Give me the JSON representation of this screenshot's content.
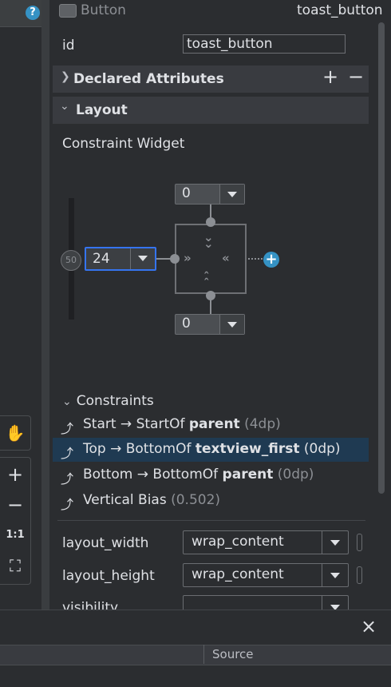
{
  "left_toolbar": {
    "help_glyph": "?",
    "tools": [
      {
        "name": "pan-hand-icon",
        "glyph": "✋"
      },
      {
        "name": "zoom-in-icon",
        "glyph": "+"
      },
      {
        "name": "zoom-out-icon",
        "glyph": "−"
      },
      {
        "name": "actual-size-icon",
        "glyph": "1:1"
      },
      {
        "name": "zoom-to-fit-icon",
        "glyph": "⛶"
      }
    ]
  },
  "header": {
    "component_type": "Button",
    "component_id": "toast_button"
  },
  "id_field": {
    "label": "id",
    "value": "toast_button"
  },
  "sections": {
    "declared_attributes": "Declared Attributes",
    "layout": "Layout",
    "add_glyph": "+",
    "remove_glyph": "−",
    "collapsed_chevron": "›",
    "expanded_chevron": "⌄"
  },
  "constraint_widget": {
    "label": "Constraint Widget",
    "top_margin": "0",
    "bottom_margin": "0",
    "start_margin": "24",
    "vertical_bias_knob": "50"
  },
  "constraints": {
    "header": "Constraints",
    "items": [
      {
        "prefix": "Start → StartOf ",
        "target": "parent",
        "suffix": " (4dp)",
        "selected": false
      },
      {
        "prefix": "Top → BottomOf ",
        "target": "textview_first",
        "suffix": " (0dp)",
        "selected": true
      },
      {
        "prefix": "Bottom → BottomOf ",
        "target": "parent",
        "suffix": " (0dp)",
        "selected": false
      },
      {
        "prefix": "Vertical Bias ",
        "target": "",
        "suffix": " (0.502)",
        "selected": false
      }
    ]
  },
  "properties": [
    {
      "label": "layout_width",
      "value": "wrap_content"
    },
    {
      "label": "layout_height",
      "value": "wrap_content"
    },
    {
      "label": "visibility",
      "value": ""
    }
  ],
  "bottom_panel": {
    "close_glyph": "×",
    "column_header": "Source"
  },
  "colors": {
    "background": "#2b2d30",
    "section_bar": "#393b40",
    "selection": "#1f3a52",
    "accent_blue": "#3574f0",
    "info_blue": "#3592c4"
  }
}
